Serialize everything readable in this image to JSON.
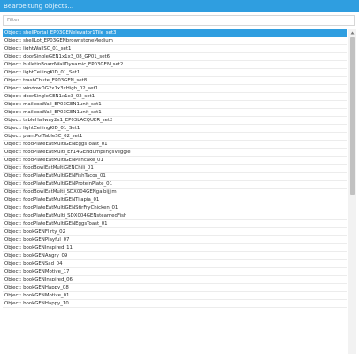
{
  "window": {
    "title": "Bearbeitung objects..."
  },
  "filter": {
    "placeholder": "Filter",
    "value": ""
  },
  "list": {
    "selected_index": 0,
    "items": [
      "Object: shellPortal_EP03GENelevator1Tile_set3",
      "Object: shellLot_EP03GENbrownstoneMedium",
      "Object: lightWallSC_01_set1",
      "Object: doorSingleGEN1x1x3_08_GP01_set6",
      "Object: bulletinBoardWallDynamic_EP03GEN_set2",
      "Object: lightCeilingKID_01_Set1",
      "Object: trashChute_EP03GEN_set8",
      "Object: windowDG2x1x3xHigh_02_set1",
      "Object: doorSingleGEN1x1x3_02_set1",
      "Object: mailboxWall_EP03GEN1unit_set1",
      "Object: mailboxWall_EP03GEN1unit_set1",
      "Object: tableHallway2x1_EP03LACQUER_set2",
      "Object: lightCeilingKID_01_Set1",
      "Object: plantPotTableSC_02_set1",
      "Object: foodPlateEatMultiGENEggsToast_01",
      "Object: foodPlateEatMulti_EF14GENdumplingsVeggie",
      "Object: foodPlateEatMultiGENPancake_01",
      "Object: foodBowlEatMultiGENChili_01",
      "Object: foodPlateEatMultiGENFishTacos_01",
      "Object: foodPlateEatMultiGENProteinPlate_01",
      "Object: foodBowlEatMulti_SDX004GENgalbijjim",
      "Object: foodPlateEatMultiGENTilapia_01",
      "Object: foodPlateEatMultiGENStirFryChicken_01",
      "Object: foodPlateEatMulti_SDX004GENsteamedFish",
      "Object: foodPlateEatMultiGENEggsToast_01",
      "Object: bookGENFlirty_02",
      "Object: bookGENPlayful_07",
      "Object: bookGENInspired_11",
      "Object: bookGENAngry_09",
      "Object: bookGENSad_04",
      "Object: bookGENMotive_17",
      "Object: bookGENInspired_06",
      "Object: bookGENHappy_08",
      "Object: bookGENMotive_01",
      "Object: bookGENHappy_10"
    ]
  },
  "scrollbar": {
    "scroll_position": 0,
    "up_arrow_icon": "chevron-up-icon"
  },
  "colors": {
    "accent": "#2f9ee0",
    "selected_text": "#ffffff",
    "row_text": "#2b2b2b",
    "row_divider": "#ececec",
    "scrollbar_track": "#f2f2f2",
    "scrollbar_thumb": "#c1c1c1"
  }
}
